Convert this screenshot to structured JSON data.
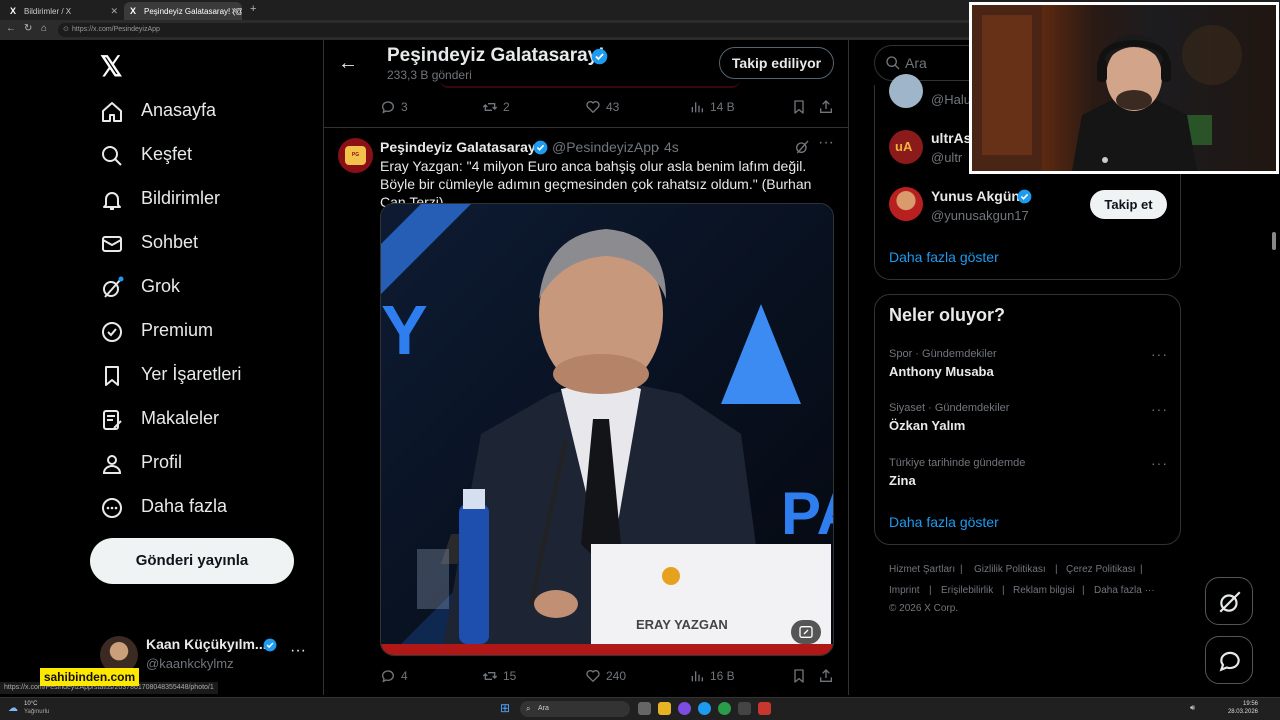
{
  "browser": {
    "tabs": [
      {
        "title": "Bildirimler / X"
      },
      {
        "title": "Peşindeyiz Galatasaray! (@Pesinde"
      }
    ],
    "new_tab": "+",
    "url": "https://x.com/PesindeyizApp",
    "status_url": "https://x.com/PesindeyizApp/status/2037861708048355448/photo/1"
  },
  "sidebar": {
    "logo": "𝕏",
    "items": [
      {
        "label": "Anasayfa",
        "icon": "home-icon"
      },
      {
        "label": "Keşfet",
        "icon": "search-icon"
      },
      {
        "label": "Bildirimler",
        "icon": "bell-icon"
      },
      {
        "label": "Sohbet",
        "icon": "mail-icon"
      },
      {
        "label": "Grok",
        "icon": "grok-icon"
      },
      {
        "label": "Premium",
        "icon": "verified-icon"
      },
      {
        "label": "Yer İşaretleri",
        "icon": "bookmark-icon"
      },
      {
        "label": "Makaleler",
        "icon": "article-icon"
      },
      {
        "label": "Profil",
        "icon": "person-icon"
      },
      {
        "label": "Daha fazla",
        "icon": "more-circle-icon"
      }
    ],
    "post_button": "Gönderi yayınla",
    "profile": {
      "name": "Kaan Küçükyılm...",
      "handle": "@kaankckylmz",
      "more": "···"
    }
  },
  "header": {
    "back": "←",
    "title": "Peşindeyiz Galatasaray!",
    "post_count": "233,3 B gönderi",
    "follow_button": "Takip ediliyor"
  },
  "prev_tweet_actions": {
    "replies": "3",
    "reposts": "2",
    "likes": "43",
    "views": "14 B"
  },
  "tweet": {
    "name": "Peşindeyiz Galatasaray!",
    "handle": "@PesindeyizApp",
    "dot": "·",
    "time": "4s",
    "more": "···",
    "text": "Eray Yazgan: \"4 milyon Euro anca bahşiş olur asla benim lafım değil. Böyle bir cümleyle adımın geçmesinden çok rahatsız oldum.\" (Burhan Can Terzi)",
    "image_nameplate": "ERAY YAZGAN",
    "actions": {
      "replies": "4",
      "reposts": "15",
      "likes": "240",
      "views": "16 B"
    }
  },
  "right": {
    "search_placeholder": "Ara",
    "who_to_follow": [
      {
        "name": "",
        "handle": "@Halu"
      },
      {
        "name": "ultrAs",
        "handle": "@ultr"
      },
      {
        "name": "Yunus Akgün",
        "handle": "@yunusakgun17"
      }
    ],
    "follow_button": "Takip et",
    "show_more": "Daha fazla göster",
    "trends_title": "Neler oluyor?",
    "trends": [
      {
        "category": "Spor · Gündemdekiler",
        "name": "Anthony Musaba"
      },
      {
        "category": "Siyaset · Gündemdekiler",
        "name": "Özkan Yalım"
      },
      {
        "category": "Türkiye tarihinde gündemde",
        "name": "Zina"
      }
    ],
    "trends_show_more": "Daha fazla göster",
    "footer": {
      "row1": [
        "Hizmet Şartları",
        "Gizlilik Politikası",
        "Çerez Politikası"
      ],
      "row2": [
        "Imprint",
        "Erişilebilirlik",
        "Reklam bilgisi",
        "Daha fazla ···"
      ],
      "copyright": "© 2026 X Corp."
    }
  },
  "overlay": {
    "badge": "sahibinden.com"
  },
  "taskbar": {
    "weather_temp": "10°C",
    "weather_desc": "Yağmurlu",
    "search": "Ara",
    "time": "19:56",
    "date": "28.03.2026"
  },
  "colors": {
    "accent": "#1d9bf0",
    "background": "#000000",
    "border": "#2f3336",
    "muted": "#71767b"
  }
}
